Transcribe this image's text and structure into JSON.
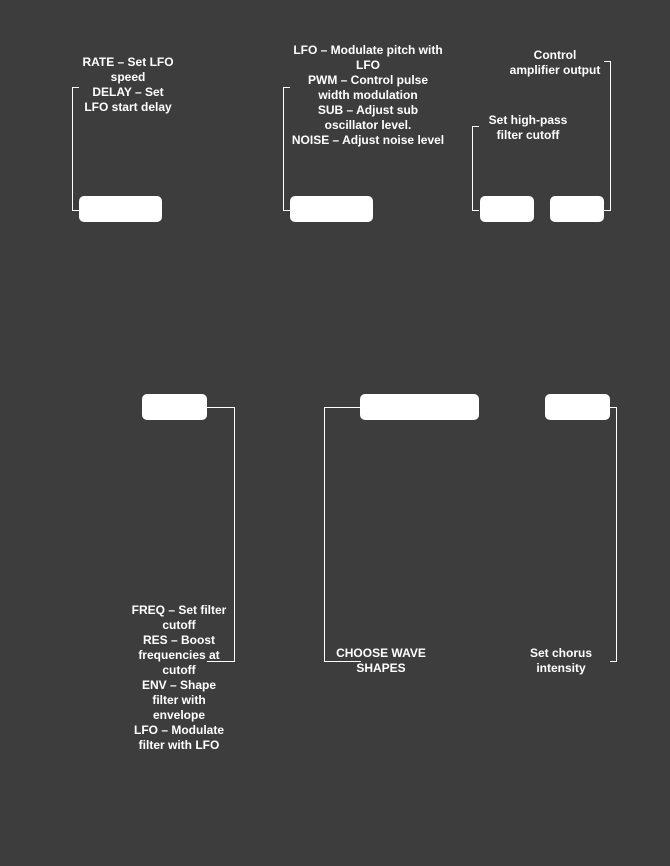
{
  "annotations": {
    "lfo": [
      "RATE – Set LFO",
      "speed",
      "DELAY – Set",
      "LFO start delay"
    ],
    "osc": [
      "LFO – Modulate pitch with",
      "LFO",
      "PWM – Control pulse",
      "width modulation",
      "SUB – Adjust sub",
      "oscillator level.",
      "NOISE – Adjust noise level"
    ],
    "amp": [
      "Control",
      "amplifier output"
    ],
    "hpf": [
      "Set high-pass",
      "filter cutoff"
    ],
    "filter": [
      "FREQ – Set filter",
      "cutoff",
      "RES – Boost",
      "frequencies at",
      "cutoff",
      "ENV – Shape",
      "filter with",
      "envelope",
      "LFO – Modulate",
      "filter with LFO"
    ],
    "wave": [
      "CHOOSE WAVE",
      "SHAPES"
    ],
    "chorus": [
      "Set chorus",
      "intensity"
    ]
  }
}
